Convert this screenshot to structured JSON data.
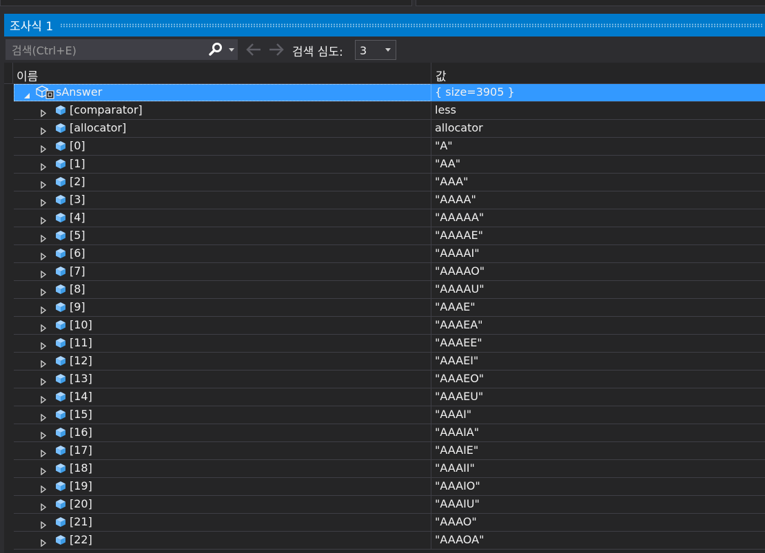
{
  "window": {
    "title": "조사식 1"
  },
  "toolbar": {
    "search_placeholder": "검색(Ctrl+E)",
    "search_icon": "search-icon",
    "back_icon": "arrow-left-icon",
    "forward_icon": "arrow-right-icon",
    "depth_label": "검색 심도:",
    "depth_value": "3"
  },
  "columns": {
    "name": "이름",
    "value": "값"
  },
  "colors": {
    "accent": "#007acc",
    "selection": "#3399ff",
    "background": "#252526",
    "cube": "#75beff"
  },
  "root": {
    "name": "sAnswer",
    "value": "{ size=3905 }",
    "expanded": true,
    "icon": "class-variable-icon"
  },
  "children": [
    {
      "name": "[comparator]",
      "value": "less"
    },
    {
      "name": "[allocator]",
      "value": "allocator"
    },
    {
      "name": "[0]",
      "value": "\"A\""
    },
    {
      "name": "[1]",
      "value": "\"AA\""
    },
    {
      "name": "[2]",
      "value": "\"AAA\""
    },
    {
      "name": "[3]",
      "value": "\"AAAA\""
    },
    {
      "name": "[4]",
      "value": "\"AAAAA\""
    },
    {
      "name": "[5]",
      "value": "\"AAAAE\""
    },
    {
      "name": "[6]",
      "value": "\"AAAAI\""
    },
    {
      "name": "[7]",
      "value": "\"AAAAO\""
    },
    {
      "name": "[8]",
      "value": "\"AAAAU\""
    },
    {
      "name": "[9]",
      "value": "\"AAAE\""
    },
    {
      "name": "[10]",
      "value": "\"AAAEA\""
    },
    {
      "name": "[11]",
      "value": "\"AAAEE\""
    },
    {
      "name": "[12]",
      "value": "\"AAAEI\""
    },
    {
      "name": "[13]",
      "value": "\"AAAEO\""
    },
    {
      "name": "[14]",
      "value": "\"AAAEU\""
    },
    {
      "name": "[15]",
      "value": "\"AAAI\""
    },
    {
      "name": "[16]",
      "value": "\"AAAIA\""
    },
    {
      "name": "[17]",
      "value": "\"AAAIE\""
    },
    {
      "name": "[18]",
      "value": "\"AAAII\""
    },
    {
      "name": "[19]",
      "value": "\"AAAIO\""
    },
    {
      "name": "[20]",
      "value": "\"AAAIU\""
    },
    {
      "name": "[21]",
      "value": "\"AAAO\""
    },
    {
      "name": "[22]",
      "value": "\"AAAOA\""
    }
  ]
}
